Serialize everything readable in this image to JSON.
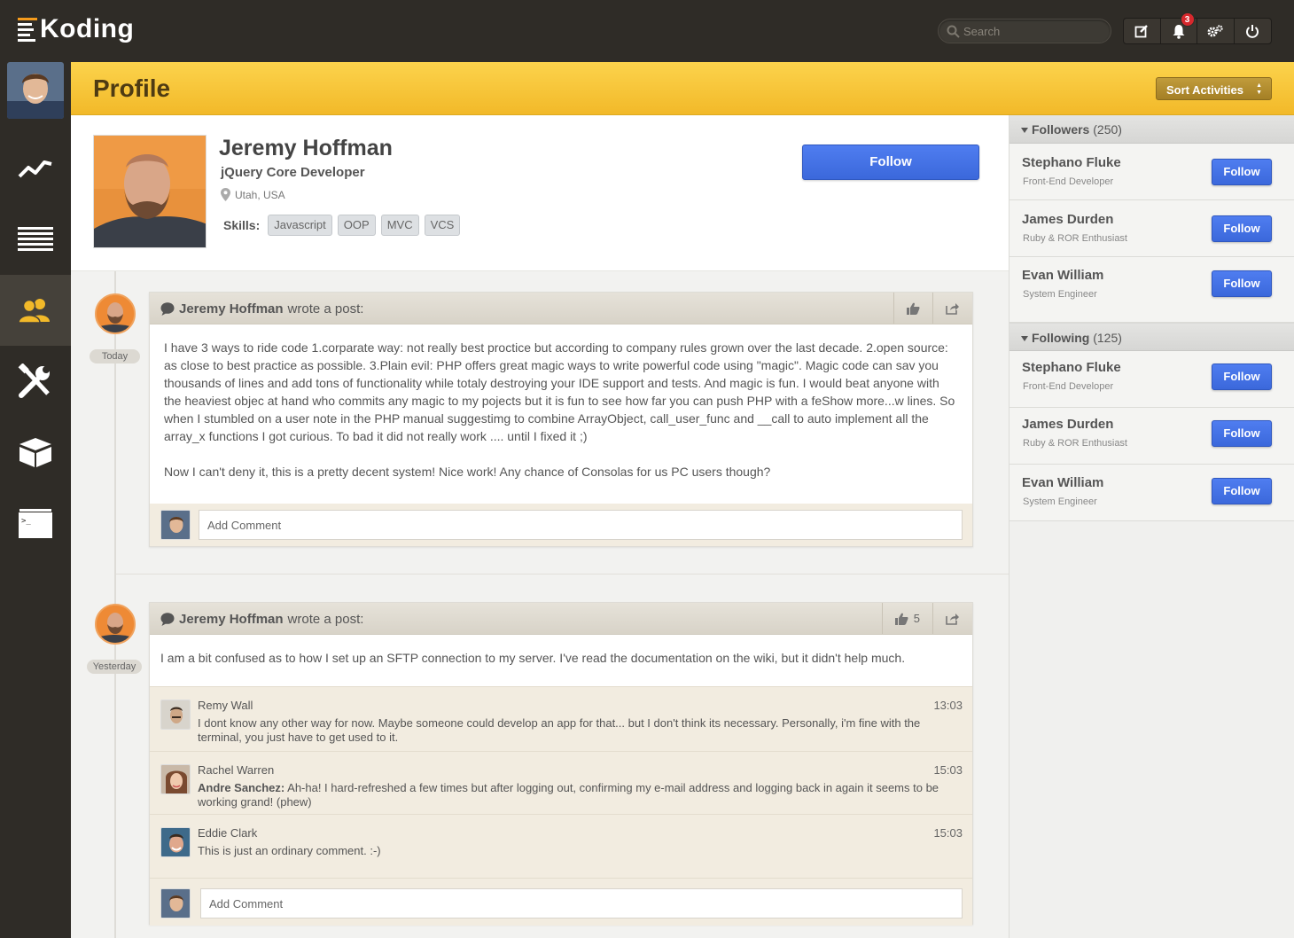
{
  "app": {
    "name": "Koding",
    "accent": "#f2b929",
    "brand_orange": "#f59b1c",
    "follow_blue": "#3b68db"
  },
  "topbar": {
    "search_placeholder": "Search",
    "notification_count": "3",
    "icons": [
      "compose-icon",
      "bell-icon",
      "gears-icon",
      "power-icon"
    ]
  },
  "sidebar": {
    "items": [
      {
        "name": "activity",
        "icon": "trend-line-icon"
      },
      {
        "name": "topics",
        "icon": "list-lines-icon"
      },
      {
        "name": "members",
        "icon": "people-icon",
        "active": true
      },
      {
        "name": "develop",
        "icon": "tools-icon"
      },
      {
        "name": "apps",
        "icon": "cube-icon"
      },
      {
        "name": "terminal",
        "icon": "terminal-icon"
      }
    ]
  },
  "header": {
    "title": "Profile",
    "sort_label": "Sort Activities"
  },
  "profile": {
    "name": "Jeremy Hoffman",
    "title": "jQuery Core Developer",
    "location": "Utah, USA",
    "skills_label": "Skills:",
    "skills": [
      "Javascript",
      "OOP",
      "MVC",
      "VCS"
    ],
    "follow_label": "Follow"
  },
  "posts": [
    {
      "author": "Jeremy Hoffman",
      "action": "wrote a post:",
      "date": "Today",
      "likes": "",
      "paragraphs": [
        "I have 3 ways to ride code 1.corparate way: not really best proctice but according to company rules grown over the last decade. 2.open source: as close to best practice as possible. 3.Plain evil: PHP offers great magic ways to write powerful code using \"magic\". Magic code can sav you thousands of lines and add tons of functionality while totaly destroying your IDE support and tests. And magic is fun. I would beat anyone with the heaviest objec at hand who commits any magic to my pojects but it is fun to see how far you can push PHP with a feShow more...w lines. So when I stumbled on a user note in the PHP manual suggestimg to combine ArrayObject, call_user_func and __call to auto implement all the array_x functions I got curious. To bad it did not really work .... until I fixed it ;)",
        "Now I can't deny it, this is a pretty decent system! Nice work! Any chance of Consolas for us PC users though?"
      ],
      "comment_placeholder": "Add Comment"
    },
    {
      "author": "Jeremy Hoffman",
      "action": "wrote a post:",
      "date": "Yesterday",
      "likes": "5",
      "paragraphs": [
        "I am a bit confused as to how I set up an SFTP connection to my server. I've read the documentation on the wiki, but it didn't help much."
      ],
      "comments": [
        {
          "name": "Remy Wall",
          "time": "13:03",
          "mention": "",
          "text": "I dont know any other way for now. Maybe someone could develop an app for that... but I don't think its necessary. Personally, i'm fine with the terminal, you just have to get used to it."
        },
        {
          "name": "Rachel Warren",
          "time": "15:03",
          "mention": "Andre Sanchez:",
          "text": " Ah-ha! I hard-refreshed a few times but after logging out, confirming my e-mail address and logging back in again it seems to be working grand! (phew)"
        },
        {
          "name": "Eddie Clark",
          "time": "15:03",
          "mention": "",
          "text": "This is just an ordinary comment. :-)"
        }
      ],
      "comment_placeholder": "Add Comment"
    }
  ],
  "followers": {
    "label": "Followers",
    "count": "(250)",
    "users": [
      {
        "name": "Stephano Fluke",
        "role": "Front-End Developer",
        "button": "Follow"
      },
      {
        "name": "James Durden",
        "role": "Ruby & ROR Enthusiast",
        "button": "Follow"
      },
      {
        "name": "Evan William",
        "role": "System Engineer",
        "button": "Follow"
      }
    ]
  },
  "following": {
    "label": "Following",
    "count": "(125)",
    "users": [
      {
        "name": "Stephano Fluke",
        "role": "Front-End Developer",
        "button": "Follow"
      },
      {
        "name": "James Durden",
        "role": "Ruby & ROR Enthusiast",
        "button": "Follow"
      },
      {
        "name": "Evan William",
        "role": "System Engineer",
        "button": "Follow"
      }
    ]
  }
}
